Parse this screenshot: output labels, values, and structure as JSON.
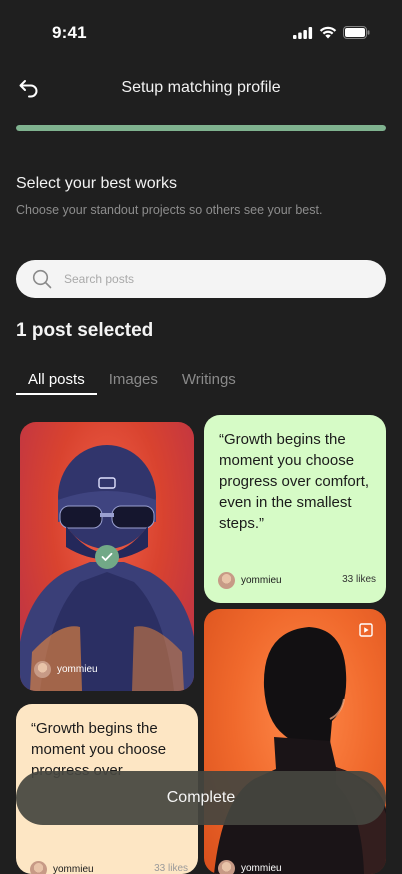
{
  "status_bar": {
    "time": "9:41"
  },
  "header": {
    "title": "Setup matching profile"
  },
  "progress": {
    "fraction": 1.0,
    "color": "#7fb28f"
  },
  "section": {
    "title": "Select your best works",
    "subtitle": "Choose your standout projects so others see your best."
  },
  "search": {
    "placeholder": "Search posts"
  },
  "selection": {
    "count_label": "1 post selected"
  },
  "tabs": [
    {
      "label": "All posts",
      "active": true
    },
    {
      "label": "Images",
      "active": false
    },
    {
      "label": "Writings",
      "active": false
    }
  ],
  "posts": [
    {
      "type": "image",
      "author": "yommieu",
      "selected": true
    },
    {
      "type": "quote",
      "text": "“Growth begins the moment you choose progress over comfort, even in the smallest steps.”",
      "author": "yommieu",
      "likes": "33 likes"
    },
    {
      "type": "video",
      "author": "yommieu",
      "selected": false
    },
    {
      "type": "quote",
      "text": "“Growth begins the moment you choose progress over",
      "author": "yommieu",
      "likes": "33 likes"
    }
  ],
  "footer": {
    "complete_label": "Complete"
  },
  "colors": {
    "background": "#1f1f1f",
    "accent": "#7fb28f",
    "quote_green": "#d6fbc6",
    "quote_peach": "#fde6c4"
  }
}
